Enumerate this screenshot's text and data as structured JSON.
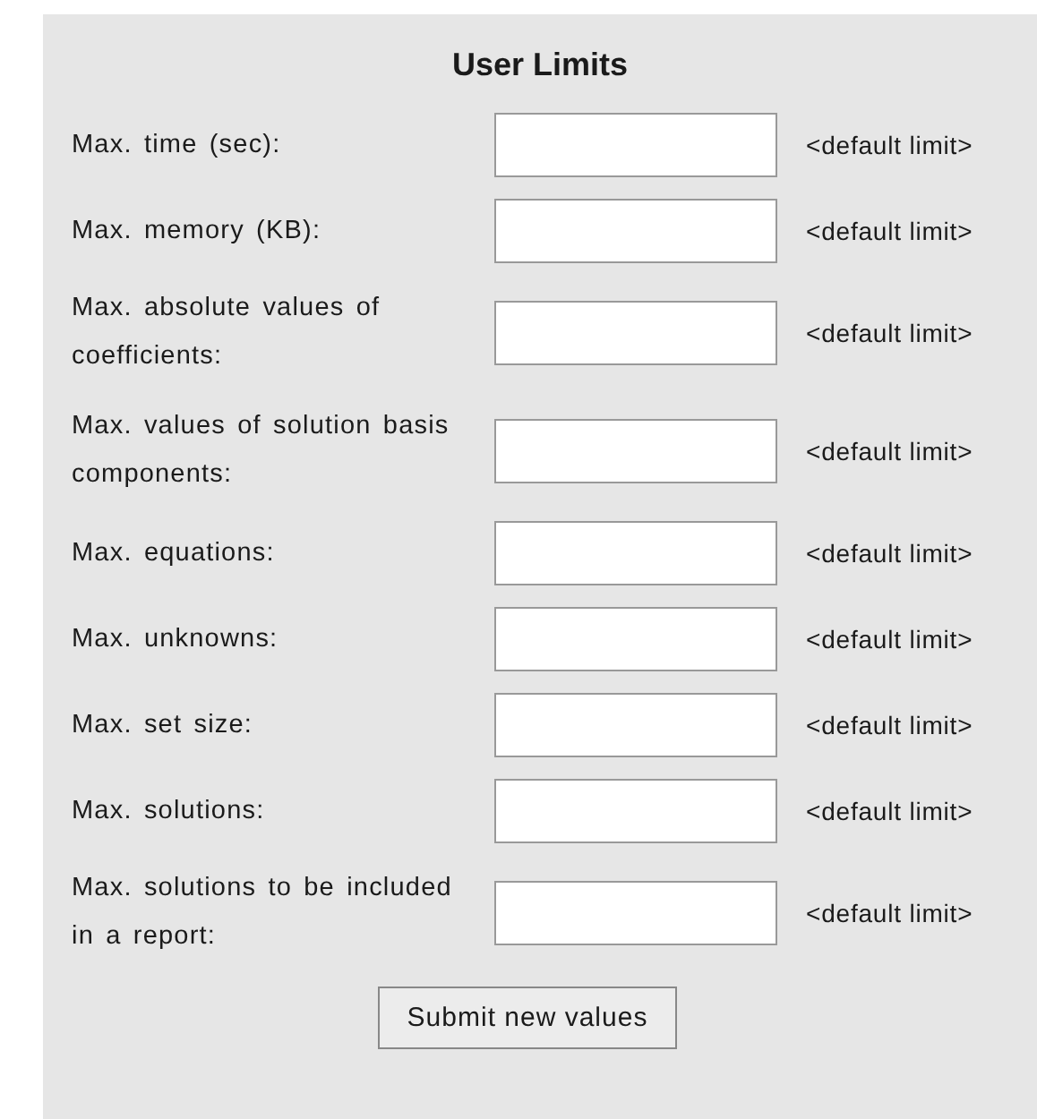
{
  "title": "User Limits",
  "fields": [
    {
      "label": "Max. time (sec):",
      "hint": "<default limit>"
    },
    {
      "label": "Max. memory (KB):",
      "hint": "<default limit>"
    },
    {
      "label": "Max. absolute values of coefficients:",
      "hint": "<default limit>"
    },
    {
      "label": "Max. values of solution basis components:",
      "hint": "<default limit>"
    },
    {
      "label": "Max. equations:",
      "hint": "<default limit>"
    },
    {
      "label": "Max. unknowns:",
      "hint": "<default limit>"
    },
    {
      "label": "Max. set size:",
      "hint": "<default limit>"
    },
    {
      "label": "Max. solutions:",
      "hint": "<default limit>"
    },
    {
      "label": "Max. solutions to be included in a report:",
      "hint": "<default limit>"
    }
  ],
  "submit": "Submit new values"
}
